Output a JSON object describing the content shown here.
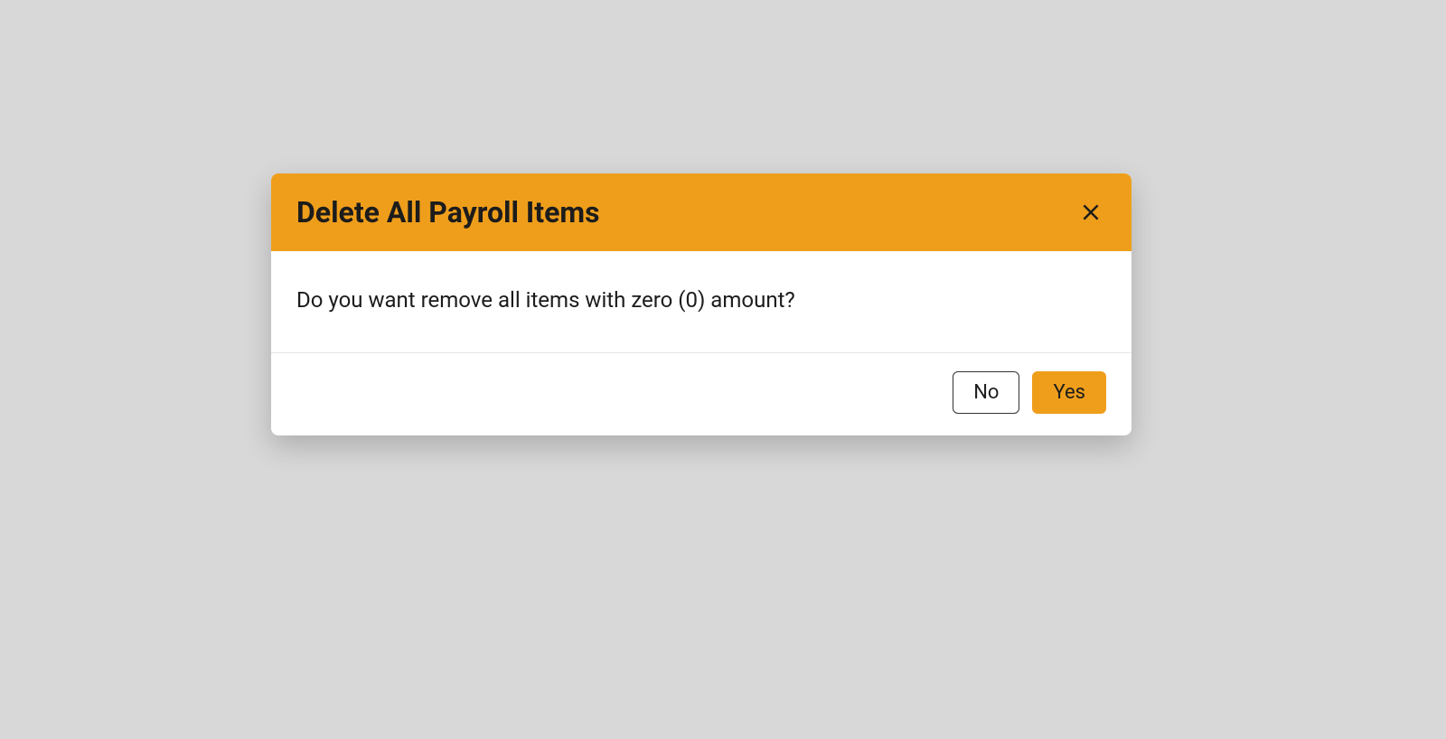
{
  "dialog": {
    "title": "Delete All Payroll Items",
    "message": "Do you want remove all items with zero (0) amount?",
    "buttons": {
      "no": "No",
      "yes": "Yes"
    }
  },
  "colors": {
    "accent": "#ef9e1b",
    "background": "#d8d8d8"
  }
}
